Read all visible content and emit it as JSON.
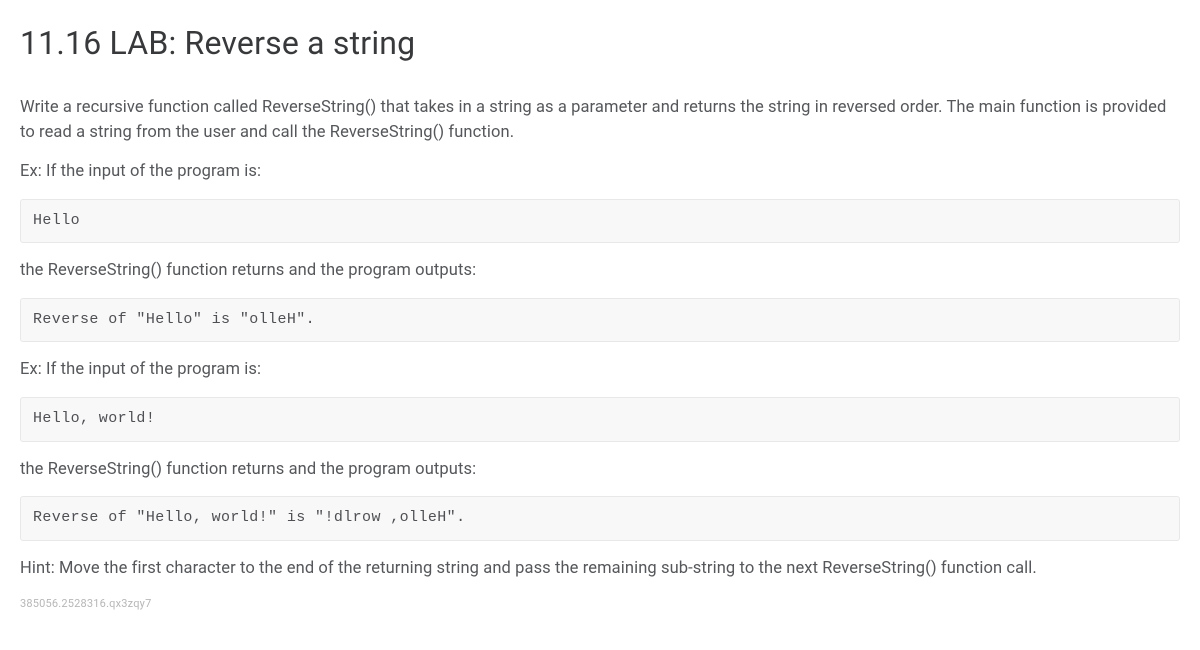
{
  "title": "11.16 LAB: Reverse a string",
  "paragraphs": {
    "intro": "Write a recursive function called ReverseString() that takes in a string as a parameter and returns the string in reversed order. The main function is provided to read a string from the user and call the ReverseString() function.",
    "ex1_lead": "Ex: If the input of the program is:",
    "ex1_out_lead": "the ReverseString() function returns and the program outputs:",
    "ex2_lead": "Ex: If the input of the program is:",
    "ex2_out_lead": "the ReverseString() function returns and the program outputs:",
    "hint": "Hint: Move the first character to the end of the returning string and pass the remaining sub-string to the next ReverseString() function call."
  },
  "code": {
    "input1": "Hello",
    "output1": "Reverse of \"Hello\" is \"olleH\".",
    "input2": "Hello, world!",
    "output2": "Reverse of \"Hello, world!\" is \"!dlrow ,olleH\"."
  },
  "footer_id": "385056.2528316.qx3zqy7"
}
